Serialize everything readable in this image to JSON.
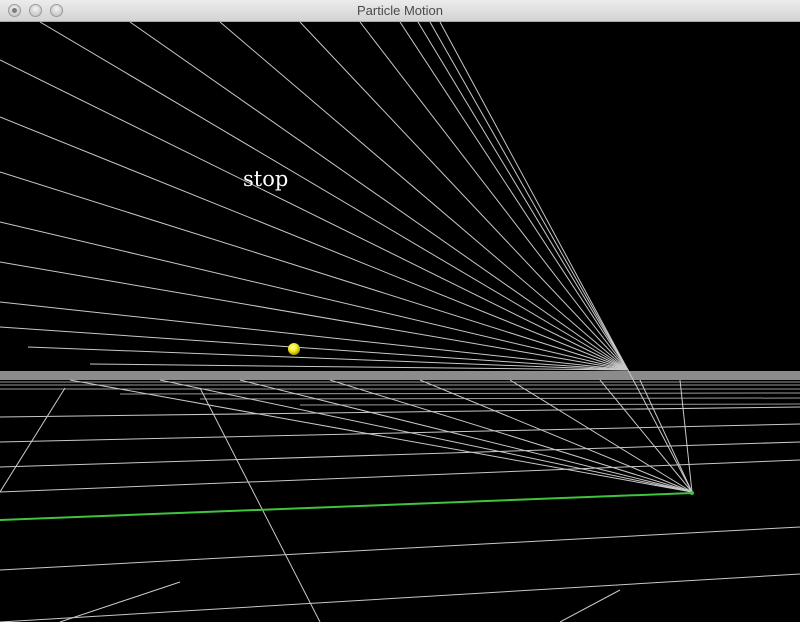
{
  "window": {
    "title": "Particle Motion"
  },
  "scene": {
    "control_label": "stop",
    "colors": {
      "background": "#000000",
      "grid_lines": "#c8c8c8",
      "horizon_band": "#8c8c8c",
      "trajectory_line": "#3ec43e",
      "particle": "#f2e61a"
    }
  }
}
